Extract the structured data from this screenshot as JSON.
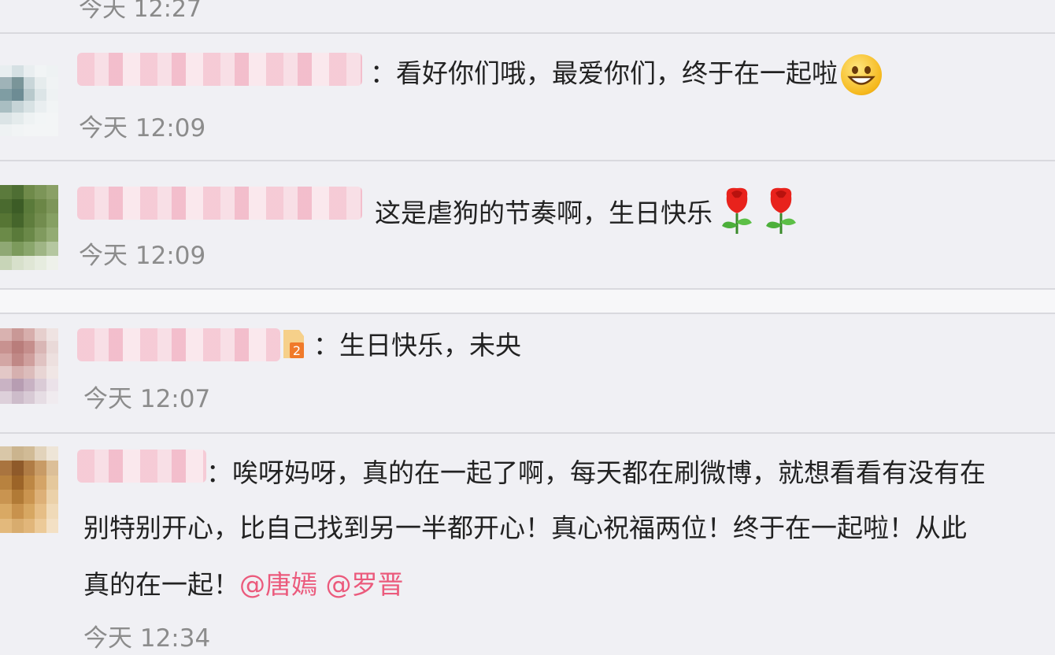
{
  "partial_time": "今天 12:27",
  "comments": [
    {
      "text": "：看好你们哦，最爱你们，终于在一起啦",
      "emoji": "smile-emoji",
      "time": "今天 12:09"
    },
    {
      "text": "这是虐狗的节奏啊，生日快乐",
      "emoji": "rose-emoji",
      "time": "今天 12:09"
    },
    {
      "text": "：生日快乐，未央",
      "badge": "level-2-badge",
      "time": "今天 12:07"
    },
    {
      "line1": "：唉呀妈呀，真的在一起了啊，每天都在刷微博，就想看看有没有在",
      "line2": "别特别开心，比自己找到另一半都开心！真心祝福两位！终于在一起啦！从此",
      "line3": "真的在一起！",
      "mention1": "@唐嫣",
      "mention2": "@罗晋",
      "time": "今天 12:34"
    }
  ],
  "colors": {
    "background": "#f0f0f4",
    "mention": "#eb5a7c",
    "time": "#8c8c8c"
  }
}
